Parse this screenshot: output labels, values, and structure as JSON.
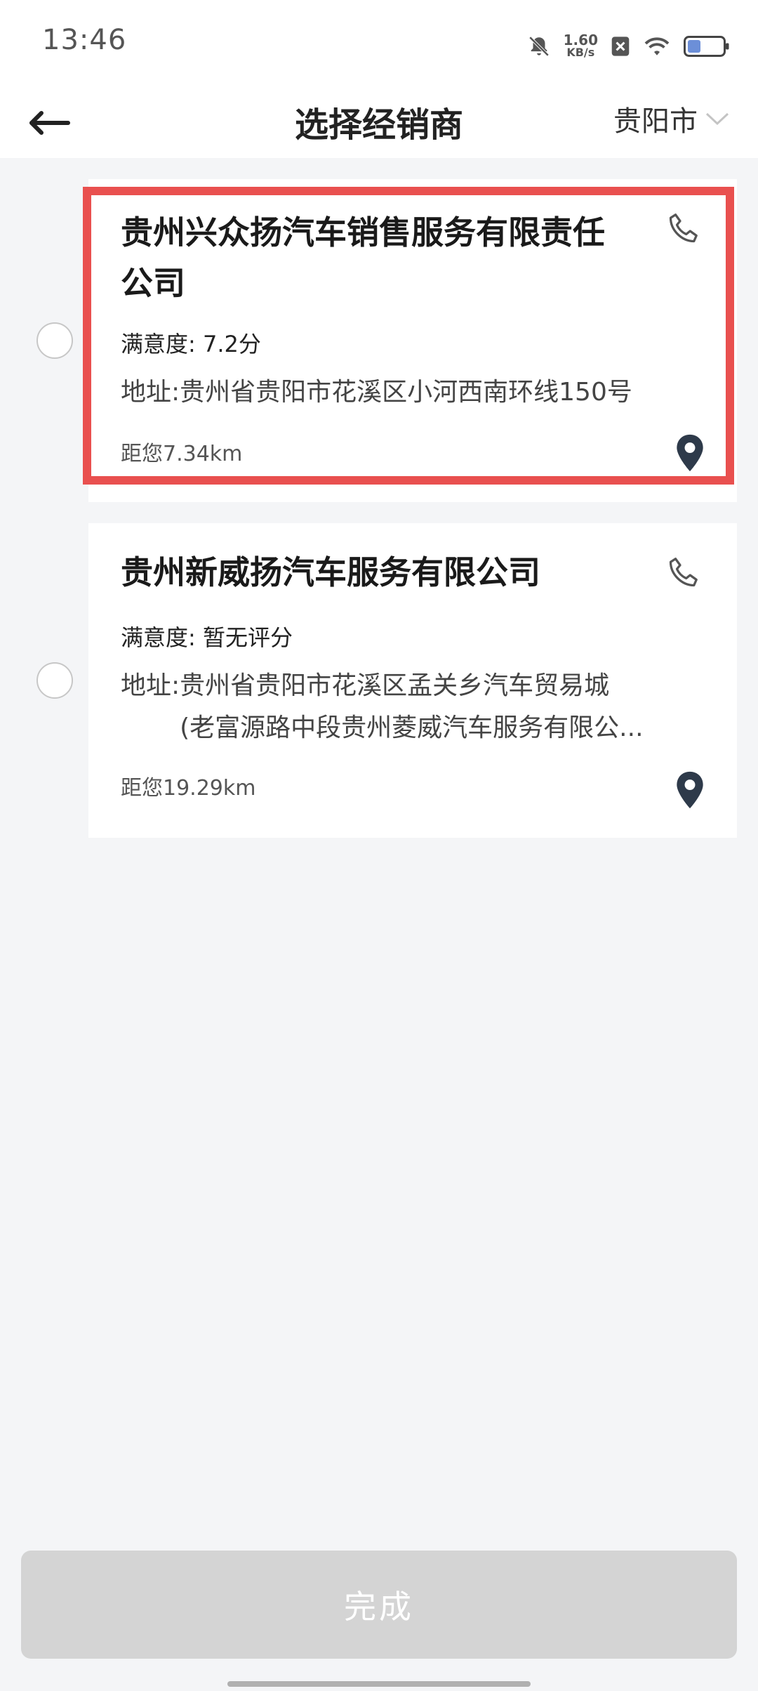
{
  "status_bar": {
    "time": "13:46",
    "net_speed_value": "1.60",
    "net_speed_unit": "KB/s",
    "icons": [
      "bell-off-icon",
      "sim-blocked-icon",
      "wifi-icon",
      "battery-icon"
    ]
  },
  "header": {
    "title": "选择经销商",
    "city": "贵阳市",
    "icons": [
      "back-arrow-icon",
      "chevron-down-icon"
    ]
  },
  "dealers": [
    {
      "name_line1": "贵州兴众扬汽车销售服务有限责任",
      "name_line2": "公司",
      "rating_label": "满意度:",
      "rating_value": "7.2分",
      "address_label": "地址:",
      "address_line1": "贵州省贵阳市花溪区小河西南环线150号",
      "address_line2": "",
      "distance": "距您7.34km",
      "selected": false
    },
    {
      "name_line1": "贵州新威扬汽车服务有限公司",
      "name_line2": "",
      "rating_label": "满意度:",
      "rating_value": "暂无评分",
      "address_label": "地址:",
      "address_line1": "贵州省贵阳市花溪区孟关乡汽车贸易城",
      "address_line2": "(老富源路中段贵州菱威汽车服务有限公...",
      "distance": "距您19.29km",
      "selected": false
    }
  ],
  "footer": {
    "done_label": "完成"
  },
  "colors": {
    "highlight": "#e9504f",
    "pin": "#2e3a4a",
    "disabled_button": "#d4d4d4"
  }
}
